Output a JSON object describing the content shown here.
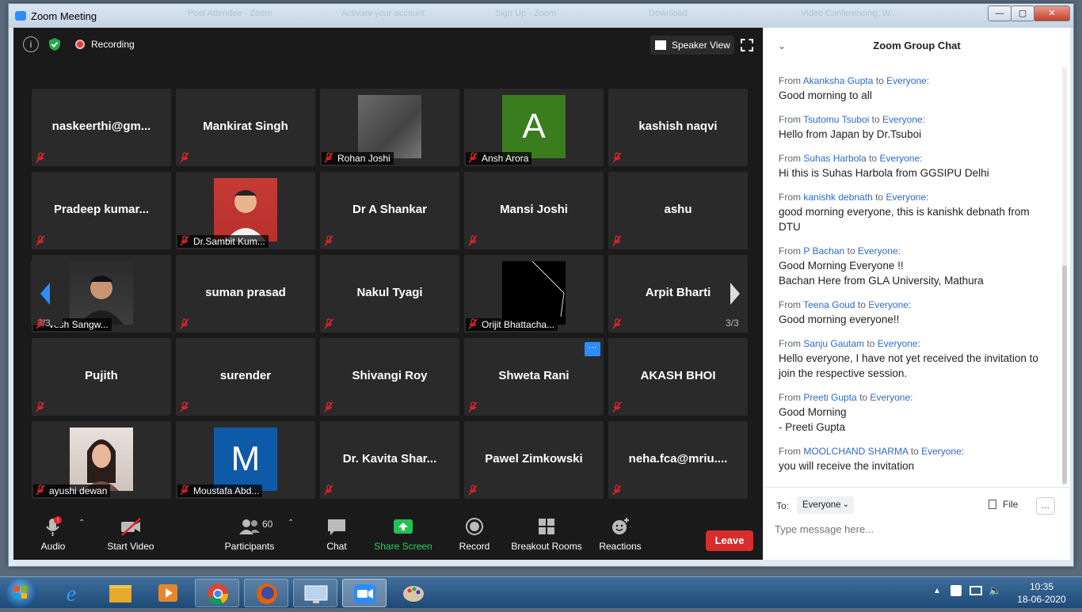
{
  "window": {
    "title": "Zoom Meeting",
    "ghost_tabs": [
      "Post Attendee - Zoom",
      "Activate your account",
      "Sign Up - Zoom",
      "Download",
      "Video Conferencing, W..."
    ]
  },
  "top": {
    "recording": "Recording",
    "speaker_view": "Speaker View"
  },
  "grid": {
    "page_left": "3/3",
    "page_right": "3/3",
    "tiles": [
      {
        "name": "naskeerthi@gm...",
        "type": "name"
      },
      {
        "name": "Mankirat Singh",
        "type": "name"
      },
      {
        "name": "Rohan Joshi",
        "type": "photo",
        "photo": "gray"
      },
      {
        "name": "Ansh Arora",
        "type": "avatar",
        "letter": "A",
        "color": "#3a7d1e"
      },
      {
        "name": "kashish naqvi",
        "type": "name"
      },
      {
        "name": "Pradeep  kumar...",
        "type": "name"
      },
      {
        "name": "Dr.Sambit Kum...",
        "type": "photo",
        "photo": "red"
      },
      {
        "name": "Dr A Shankar",
        "type": "name"
      },
      {
        "name": "Mansi Joshi",
        "type": "name"
      },
      {
        "name": "ashu",
        "type": "name"
      },
      {
        "name": "vesh Sangw...",
        "type": "photo",
        "photo": "person"
      },
      {
        "name": "suman prasad",
        "type": "name"
      },
      {
        "name": "Nakul Tyagi",
        "type": "name"
      },
      {
        "name": "Orijit Bhattacha...",
        "type": "photo",
        "photo": "black"
      },
      {
        "name": "Arpit Bharti",
        "type": "name"
      },
      {
        "name": "Pujith",
        "type": "name"
      },
      {
        "name": "surender",
        "type": "name"
      },
      {
        "name": "Shivangi Roy",
        "type": "name"
      },
      {
        "name": "Shweta Rani",
        "type": "name"
      },
      {
        "name": "AKASH BHOI",
        "type": "name"
      },
      {
        "name": "ayushi dewan",
        "type": "photo",
        "photo": "woman"
      },
      {
        "name": "Moustafa Abd...",
        "type": "avatar",
        "letter": "M",
        "color": "#0f5aa8"
      },
      {
        "name": "Dr.  Kavita Shar...",
        "type": "name"
      },
      {
        "name": "Pawel Zimkowski",
        "type": "name"
      },
      {
        "name": "neha.fca@mriu....",
        "type": "name"
      }
    ]
  },
  "toolbar": {
    "audio": "Audio",
    "start_video": "Start Video",
    "participants": "Participants",
    "participants_count": "60",
    "chat": "Chat",
    "share_screen": "Share Screen",
    "record": "Record",
    "breakout": "Breakout Rooms",
    "reactions": "Reactions",
    "leave": "Leave",
    "more": "..."
  },
  "chat": {
    "title": "Zoom Group Chat",
    "to_label": "To:",
    "to_value": "Everyone",
    "file": "File",
    "placeholder": "Type message here...",
    "messages": [
      {
        "from": "Akanksha Gupta",
        "to": "Everyone:",
        "text": "Good morning to all"
      },
      {
        "from": "Tsutomu Tsuboi",
        "to": "Everyone:",
        "text": "Hello from Japan by Dr.Tsuboi"
      },
      {
        "from": "Suhas Harbola",
        "to": "Everyone:",
        "text": "Hi this is Suhas Harbola from GGSIPU Delhi"
      },
      {
        "from": "kanishk debnath",
        "to": "Everyone:",
        "text": "good morning everyone, this is kanishk debnath from DTU"
      },
      {
        "from": "P Bachan",
        "to": "Everyone:",
        "text": "Good Morning Everyone !!\nBachan Here from GLA University, Mathura"
      },
      {
        "from": "Teena Goud",
        "to": "Everyone:",
        "text": "Good morning everyone!!"
      },
      {
        "from": "Sanju Gautam",
        "to": "Everyone:",
        "text": "Hello everyone, I have not yet received the invitation to join the respective session."
      },
      {
        "from": "Preeti Gupta",
        "to": "Everyone:",
        "text": "Good Morning\n- Preeti Gupta"
      },
      {
        "from": "MOOLCHAND SHARMA",
        "to": "Everyone:",
        "text": "you will receive the invitation"
      }
    ],
    "from_word": "From",
    "to_word": "to"
  },
  "taskbar": {
    "time": "10:35",
    "date": "18-06-2020"
  }
}
